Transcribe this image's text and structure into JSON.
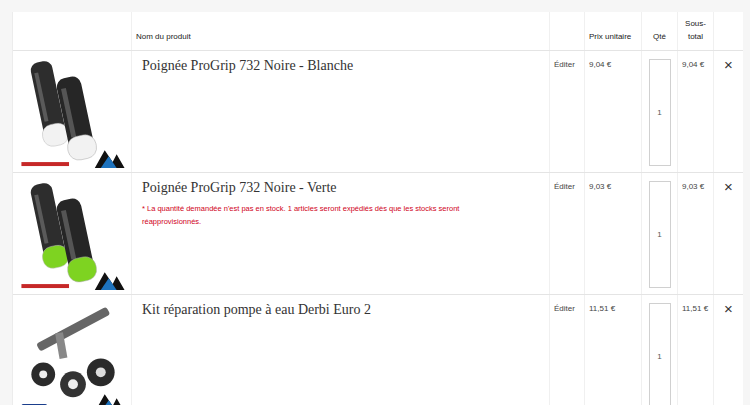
{
  "table": {
    "columns": [
      "Nom du produit",
      "Prix unitaire",
      "Qté",
      "Sous-total"
    ],
    "rows": [
      {
        "kind": "grip",
        "color": "#f2f2f2",
        "name": "Poignée ProGrip 732 Noire - Blanche",
        "edit": "Éditer",
        "unit_price": "9,04 €",
        "qty": "1",
        "subtotal": "9,04 €",
        "remove": "×",
        "warning": ""
      },
      {
        "kind": "grip",
        "color": "#7ed321",
        "name": "Poignée ProGrip 732 Noire - Verte",
        "edit": "Éditer",
        "unit_price": "9,03 €",
        "qty": "1",
        "subtotal": "9,03 €",
        "remove": "×",
        "warning": "* La quantité demandée n'est pas en stock. 1 articles seront expédiés dès que les stocks seront réapprovisionnés."
      },
      {
        "kind": "kit",
        "color": "#555555",
        "name": "Kit réparation pompe à eau Derbi Euro 2",
        "edit": "Éditer",
        "unit_price": "11,51 €",
        "qty": "1",
        "subtotal": "11,51 €",
        "remove": "×",
        "warning": ""
      }
    ]
  }
}
